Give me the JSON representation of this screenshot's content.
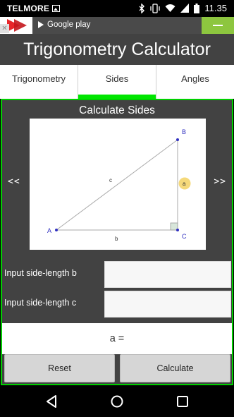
{
  "status_bar": {
    "carrier": "TELMORE",
    "time": "11.35",
    "icons": [
      "image-icon",
      "bluetooth-icon",
      "vibrate-icon",
      "wifi-icon",
      "signal-icon",
      "battery-icon"
    ]
  },
  "ad": {
    "label": "Google play",
    "close_glyph": "✕"
  },
  "app": {
    "title": "Trigonometry Calculator"
  },
  "tabs": [
    {
      "label": "Trigonometry",
      "selected": false
    },
    {
      "label": "Sides",
      "selected": true
    },
    {
      "label": "Angles",
      "selected": false
    }
  ],
  "panel": {
    "title": "Calculate Sides",
    "prev_label": "<<",
    "next_label": ">>",
    "diagram": {
      "vertex_a": "A",
      "vertex_b": "B",
      "vertex_c": "C",
      "side_a": "a",
      "side_b": "b",
      "side_c": "c"
    }
  },
  "inputs": {
    "side_b_label": "Input side-length b",
    "side_b_value": "",
    "side_c_label": "Input side-length c",
    "side_c_value": ""
  },
  "result": {
    "text": "a ="
  },
  "buttons": {
    "reset": "Reset",
    "calculate": "Calculate"
  },
  "colors": {
    "accent": "#00e600",
    "header_bg": "#424242",
    "highlight": "#f5d97a"
  }
}
